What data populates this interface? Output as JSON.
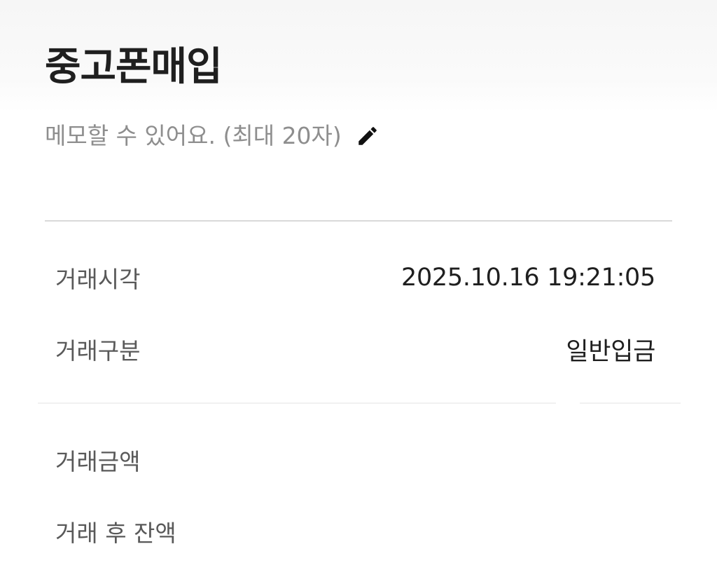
{
  "header": {
    "title": "중고폰매입"
  },
  "memo": {
    "placeholder": "메모할 수 있어요. (최대 20자)",
    "edit_icon": "pencil-icon"
  },
  "details": {
    "rows": [
      {
        "label": "거래시각",
        "value": "2025.10.16 19:21:05"
      },
      {
        "label": "거래구분",
        "value": "일반입금"
      },
      {
        "label": "거래금액",
        "value": ""
      },
      {
        "label": "거래 후 잔액",
        "value": ""
      }
    ]
  },
  "colors": {
    "text_primary": "#1f1f1f",
    "text_label": "#595959",
    "text_placeholder": "#8e8e8e",
    "divider": "#d9d9d9"
  }
}
